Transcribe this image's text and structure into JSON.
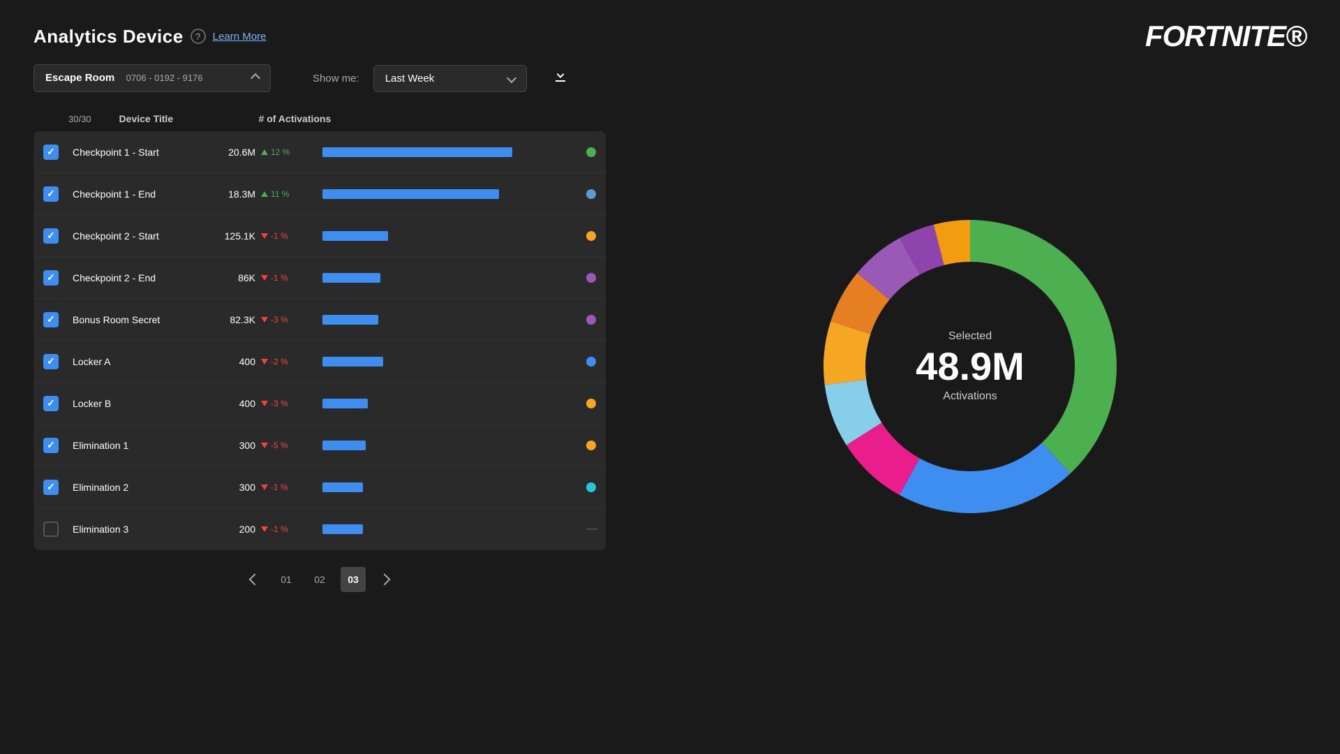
{
  "header": {
    "title": "Analytics Device",
    "learn_more": "Learn More",
    "logo": "FORTNITE"
  },
  "controls": {
    "map_name": "Escape Room",
    "map_id": "0706 - 0192 - 9176",
    "show_me_label": "Show me:",
    "time_period": "Last Week"
  },
  "table": {
    "page_count": "30/30",
    "col_device": "Device Title",
    "col_activations": "# of Activations",
    "rows": [
      {
        "id": 1,
        "checked": true,
        "name": "Checkpoint 1 - Start",
        "count": "20.6M",
        "trend_dir": "up",
        "trend_val": "12 %",
        "bar_pct": 75,
        "dot_color": "#4caf50"
      },
      {
        "id": 2,
        "checked": true,
        "name": "Checkpoint 1 - End",
        "count": "18.3M",
        "trend_dir": "up",
        "trend_val": "11 %",
        "bar_pct": 70,
        "dot_color": "#5b9bd5"
      },
      {
        "id": 3,
        "checked": true,
        "name": "Checkpoint 2 - Start",
        "count": "125.1K",
        "trend_dir": "down",
        "trend_val": "-1 %",
        "bar_pct": 26,
        "dot_color": "#f5a623"
      },
      {
        "id": 4,
        "checked": true,
        "name": "Checkpoint 2 - End",
        "count": "86K",
        "trend_dir": "down",
        "trend_val": "-1 %",
        "bar_pct": 23,
        "dot_color": "#9b59b6"
      },
      {
        "id": 5,
        "checked": true,
        "name": "Bonus Room Secret",
        "count": "82.3K",
        "trend_dir": "down",
        "trend_val": "-3 %",
        "bar_pct": 22,
        "dot_color": "#9b59b6"
      },
      {
        "id": 6,
        "checked": true,
        "name": "Locker A",
        "count": "400",
        "trend_dir": "down",
        "trend_val": "-2 %",
        "bar_pct": 24,
        "dot_color": "#3d8ef0"
      },
      {
        "id": 7,
        "checked": true,
        "name": "Locker B",
        "count": "400",
        "trend_dir": "down",
        "trend_val": "-3 %",
        "bar_pct": 18,
        "dot_color": "#f5a623"
      },
      {
        "id": 8,
        "checked": true,
        "name": "Elimination 1",
        "count": "300",
        "trend_dir": "down",
        "trend_val": "-5 %",
        "bar_pct": 17,
        "dot_color": "#f5a623"
      },
      {
        "id": 9,
        "checked": true,
        "name": "Elimination 2",
        "count": "300",
        "trend_dir": "down",
        "trend_val": "-1 %",
        "bar_pct": 16,
        "dot_color": "#26c6da"
      },
      {
        "id": 10,
        "checked": false,
        "name": "Elimination 3",
        "count": "200",
        "trend_dir": "down",
        "trend_val": "-1 %",
        "bar_pct": 16,
        "dot_color": null
      }
    ]
  },
  "donut": {
    "label": "Selected",
    "value": "48.9M",
    "sublabel": "Activations",
    "segments": [
      {
        "color": "#4caf50",
        "pct": 38
      },
      {
        "color": "#3d8ef0",
        "pct": 20
      },
      {
        "color": "#e91e8c",
        "pct": 8
      },
      {
        "color": "#87ceeb",
        "pct": 7
      },
      {
        "color": "#f5a623",
        "pct": 7
      },
      {
        "color": "#e67e22",
        "pct": 6
      },
      {
        "color": "#9b59b6",
        "pct": 6
      },
      {
        "color": "#8e44ad",
        "pct": 4
      },
      {
        "color": "#f39c12",
        "pct": 4
      }
    ]
  },
  "pagination": {
    "prev_label": "",
    "pages": [
      "01",
      "02",
      "03"
    ],
    "active_page": "03",
    "next_label": ""
  }
}
